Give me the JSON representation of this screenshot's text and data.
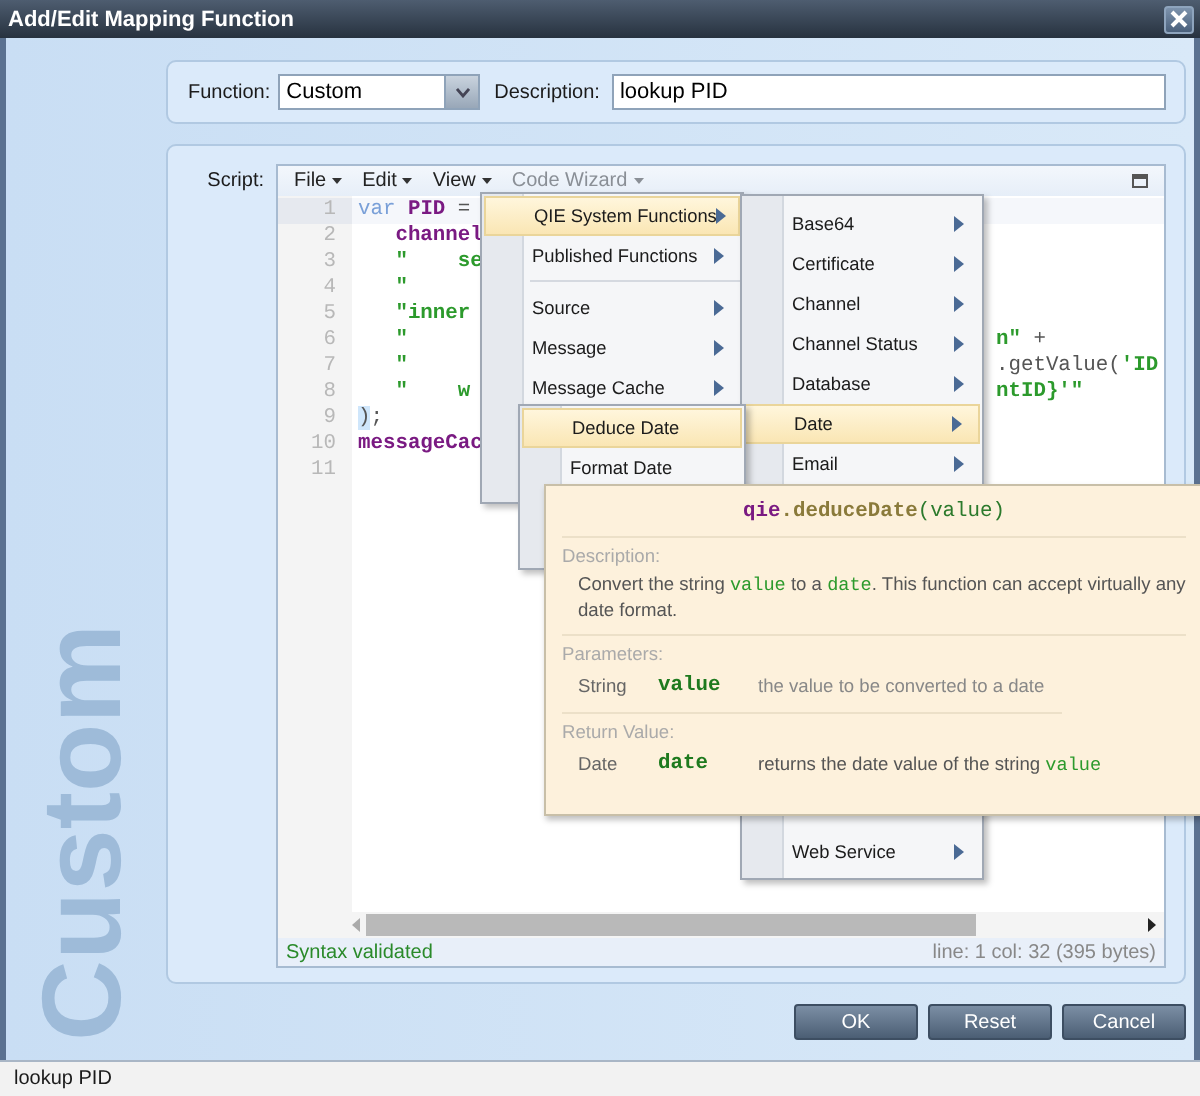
{
  "window": {
    "title": "Add/Edit Mapping Function"
  },
  "side_label": "Custom",
  "function_field": {
    "label": "Function:",
    "value": "Custom"
  },
  "description_field": {
    "label": "Description:",
    "value": "lookup PID"
  },
  "script": {
    "label": "Script:",
    "menus": [
      {
        "label": "File",
        "open": false
      },
      {
        "label": "Edit",
        "open": false
      },
      {
        "label": "View",
        "open": false
      },
      {
        "label": "Code Wizard",
        "open": true
      }
    ],
    "lines": [
      {
        "number": "1",
        "current": true,
        "left": [
          {
            "kind": "keyword",
            "text": "var "
          },
          {
            "kind": "ident",
            "text": "PID"
          },
          {
            "kind": "plain",
            "text": " ="
          }
        ]
      },
      {
        "number": "2",
        "current": false,
        "left": [
          {
            "kind": "ident",
            "text": "   channel"
          }
        ]
      },
      {
        "number": "3",
        "current": false,
        "left": [
          {
            "kind": "string",
            "text": "   \"    se"
          }
        ]
      },
      {
        "number": "4",
        "current": false,
        "left": [
          {
            "kind": "string",
            "text": "   \""
          }
        ]
      },
      {
        "number": "5",
        "current": false,
        "left": [
          {
            "kind": "string",
            "text": "   \"inner"
          }
        ]
      },
      {
        "number": "6",
        "current": false,
        "left": [
          {
            "kind": "string",
            "text": "   \""
          }
        ],
        "right": [
          {
            "kind": "string",
            "text": "n\""
          },
          {
            "kind": "plain",
            "text": " +"
          }
        ]
      },
      {
        "number": "7",
        "current": false,
        "left": [
          {
            "kind": "string",
            "text": "   \""
          }
        ],
        "right": [
          {
            "kind": "plain",
            "text": ".getValue("
          },
          {
            "kind": "string",
            "text": "'ID"
          }
        ]
      },
      {
        "number": "8",
        "current": false,
        "left": [
          {
            "kind": "string",
            "text": "   \"    w"
          }
        ],
        "right": [
          {
            "kind": "string",
            "text": "ntID}'\""
          }
        ]
      },
      {
        "number": "9",
        "current": false,
        "left": [
          {
            "kind": "bracket",
            "text": ")"
          },
          {
            "kind": "plain",
            "text": ";"
          }
        ]
      },
      {
        "number": "10",
        "current": false,
        "left": [
          {
            "kind": "ident",
            "text": "messageCac"
          }
        ]
      },
      {
        "number": "11",
        "current": false
      }
    ],
    "status": "Syntax validated",
    "position": "line: 1  col: 32  (395 bytes)"
  },
  "code_wizard_menu": {
    "items": [
      {
        "kind": "item",
        "label": "QIE System Functions",
        "selected": true,
        "submenu": true
      },
      {
        "kind": "item",
        "label": "Published Functions",
        "selected": false,
        "submenu": true
      },
      {
        "kind": "separator"
      },
      {
        "kind": "item",
        "label": "Source",
        "selected": false,
        "submenu": true
      },
      {
        "kind": "item",
        "label": "Message",
        "selected": false,
        "submenu": true
      },
      {
        "kind": "item",
        "label": "Message Cache",
        "selected": false,
        "submenu": true
      }
    ]
  },
  "category_menu": {
    "items": [
      {
        "kind": "item",
        "label": "Base64",
        "selected": false,
        "submenu": true
      },
      {
        "kind": "item",
        "label": "Certificate",
        "selected": false,
        "submenu": true
      },
      {
        "kind": "item",
        "label": "Channel",
        "selected": false,
        "submenu": true
      },
      {
        "kind": "item",
        "label": "Channel Status",
        "selected": false,
        "submenu": true
      },
      {
        "kind": "item",
        "label": "Database",
        "selected": false,
        "submenu": true
      },
      {
        "kind": "item",
        "label": "Date",
        "selected": true,
        "submenu": true
      },
      {
        "kind": "item",
        "label": "Email",
        "selected": false,
        "submenu": true
      }
    ],
    "bottom_items": [
      {
        "kind": "item",
        "label": "Web Service",
        "selected": false,
        "submenu": true
      }
    ]
  },
  "date_menu": {
    "items": [
      {
        "kind": "item",
        "label": "Deduce Date",
        "selected": true,
        "submenu": false
      },
      {
        "kind": "item",
        "label": "Format Date",
        "selected": false,
        "submenu": false
      }
    ]
  },
  "tooltip": {
    "signature": [
      {
        "kind": "object",
        "text": "qie"
      },
      {
        "kind": "method",
        "text": ".deduceDate"
      },
      {
        "kind": "param",
        "text": "(value)"
      }
    ],
    "description_heading": "Description:",
    "description": [
      {
        "kind": "plain",
        "text": "Convert the string "
      },
      {
        "kind": "code",
        "text": "value"
      },
      {
        "kind": "plain",
        "text": " to a "
      },
      {
        "kind": "code",
        "text": "date"
      },
      {
        "kind": "plain",
        "text": ". This function can accept virtually any date format."
      }
    ],
    "parameters_heading": "Parameters:",
    "parameters": [
      {
        "type": "String",
        "name": "value",
        "description": "the value to be converted to a date"
      }
    ],
    "return_heading": "Return Value:",
    "return": {
      "type": "Date",
      "name": "date",
      "description": [
        {
          "kind": "plain",
          "text": "returns the date value of the string "
        },
        {
          "kind": "code",
          "text": "value"
        }
      ]
    }
  },
  "buttons": [
    {
      "label": "OK"
    },
    {
      "label": "Reset"
    },
    {
      "label": "Cancel"
    }
  ],
  "status_bar": "lookup PID"
}
